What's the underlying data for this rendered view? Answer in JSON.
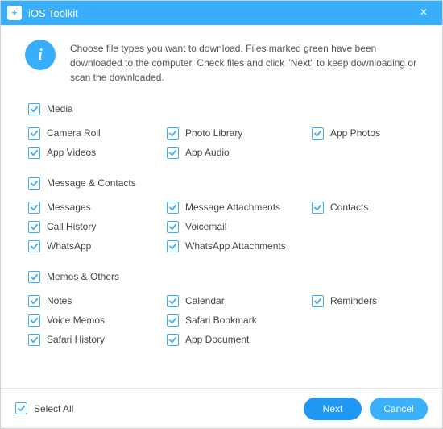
{
  "window": {
    "title": "iOS Toolkit",
    "info": "Choose file types you want to download. Files marked green have been downloaded to the computer. Check files and click \"Next\" to keep downloading or scan the downloaded."
  },
  "groups": [
    {
      "name": "media",
      "header": "Media",
      "items": [
        {
          "label": "Camera Roll",
          "col": 0
        },
        {
          "label": "Photo Library",
          "col": 1
        },
        {
          "label": "App Photos",
          "col": 2
        },
        {
          "label": "App Videos",
          "col": 0
        },
        {
          "label": "App Audio",
          "col": 1
        }
      ]
    },
    {
      "name": "message-contacts",
      "header": "Message & Contacts",
      "items": [
        {
          "label": "Messages",
          "col": 0
        },
        {
          "label": "Message Attachments",
          "col": 1
        },
        {
          "label": "Contacts",
          "col": 2
        },
        {
          "label": "Call History",
          "col": 0
        },
        {
          "label": "Voicemail",
          "col": 1
        },
        {
          "label": "WhatsApp",
          "col": 0
        },
        {
          "label": "WhatsApp Attachments",
          "col": 1
        }
      ]
    },
    {
      "name": "memos-others",
      "header": "Memos & Others",
      "items": [
        {
          "label": "Notes",
          "col": 0
        },
        {
          "label": "Calendar",
          "col": 1
        },
        {
          "label": "Reminders",
          "col": 2
        },
        {
          "label": "Voice Memos",
          "col": 0
        },
        {
          "label": "Safari Bookmark",
          "col": 1
        },
        {
          "label": "Safari History",
          "col": 0
        },
        {
          "label": "App Document",
          "col": 1
        }
      ]
    }
  ],
  "footer": {
    "select_all": "Select All",
    "next": "Next",
    "cancel": "Cancel"
  },
  "colors": {
    "accent": "#39aefc",
    "primary_btn": "#1f98f3"
  }
}
